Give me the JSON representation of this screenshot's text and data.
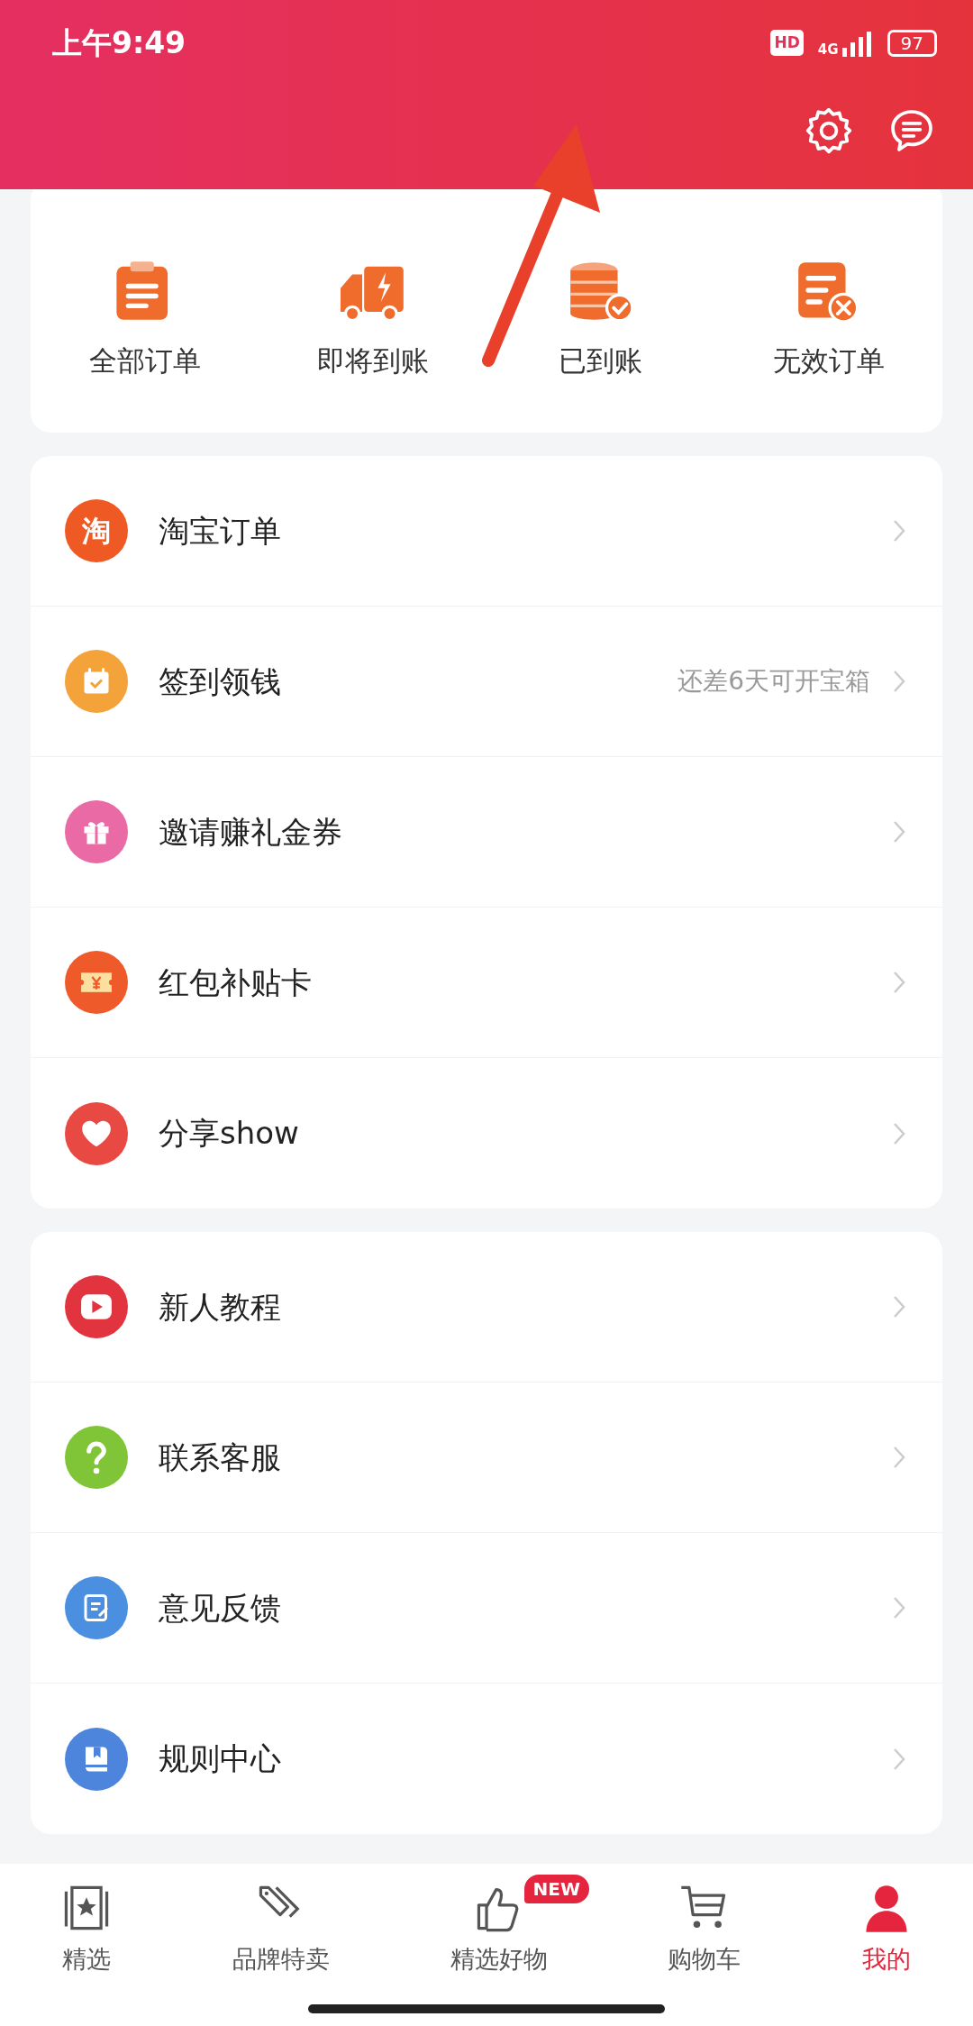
{
  "status_bar": {
    "time": "上午9:49",
    "hd": "HD",
    "network": "4G",
    "battery": "97"
  },
  "order_summary": {
    "items": [
      {
        "label": "全部订单"
      },
      {
        "label": "即将到账"
      },
      {
        "label": "已到账"
      },
      {
        "label": "无效订单"
      }
    ]
  },
  "menu_groups": [
    {
      "items": [
        {
          "label": "淘宝订单",
          "icon_text": "淘",
          "color": "#ef5a24"
        },
        {
          "label": "签到领钱",
          "hint": "还差6天可开宝箱",
          "color": "#f3a33a"
        },
        {
          "label": "邀请赚礼金券",
          "color": "#ea6aa6"
        },
        {
          "label": "红包补贴卡",
          "color": "#ef5a2a"
        },
        {
          "label": "分享show",
          "color": "#e84a43"
        }
      ]
    },
    {
      "items": [
        {
          "label": "新人教程",
          "color": "#e1343f"
        },
        {
          "label": "联系客服",
          "color": "#7fc537"
        },
        {
          "label": "意见反馈",
          "color": "#4b8fe0"
        },
        {
          "label": "规则中心",
          "color": "#4e85dc"
        }
      ]
    }
  ],
  "bottom_nav": [
    {
      "label": "精选",
      "selected": false
    },
    {
      "label": "品牌特卖",
      "selected": false
    },
    {
      "label": "精选好物",
      "selected": false,
      "badge": "NEW"
    },
    {
      "label": "购物车",
      "selected": false
    },
    {
      "label": "我的",
      "selected": true
    }
  ]
}
